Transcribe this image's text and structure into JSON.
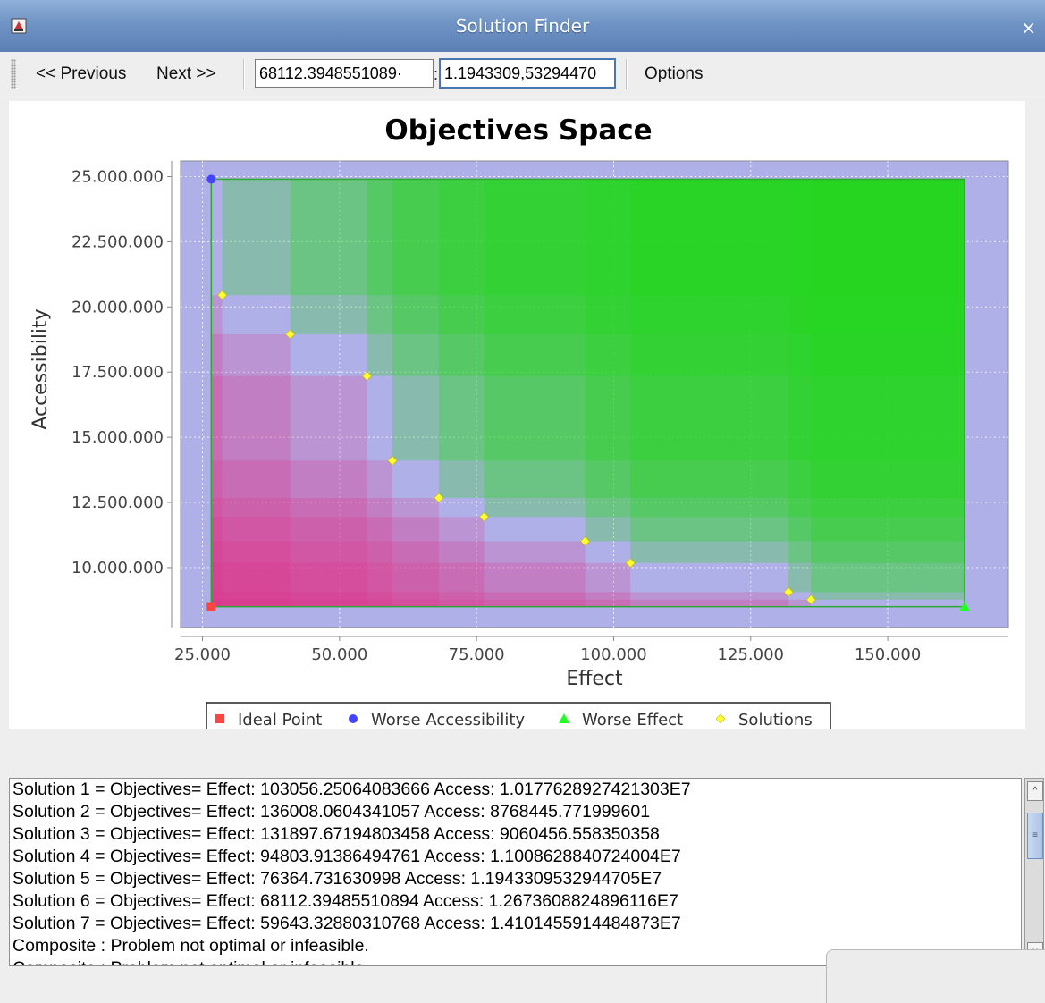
{
  "window": {
    "title": "Solution Finder",
    "close_glyph": "×",
    "app_icon": "app-icon"
  },
  "toolbar": {
    "previous_label": "<< Previous",
    "next_label": "Next >>",
    "field1_value": "68112.3948551089·",
    "colon": ":",
    "field2_value": "1.1943309,53294470",
    "options_label": "Options"
  },
  "chart_data": {
    "type": "scatter",
    "title": "Objectives Space",
    "xlabel": "Effect",
    "ylabel": "Accessibility",
    "xlim": [
      21000,
      172000
    ],
    "ylim": [
      7700000,
      25600000
    ],
    "xticks": [
      25000,
      50000,
      75000,
      100000,
      125000,
      150000
    ],
    "xtick_labels": [
      "25.000",
      "50.000",
      "75.000",
      "100.000",
      "125.000",
      "150.000"
    ],
    "yticks": [
      10000000,
      12500000,
      15000000,
      17500000,
      20000000,
      22500000,
      25000000
    ],
    "ytick_labels": [
      "10.000.000",
      "12.500.000",
      "15.000.000",
      "17.500.000",
      "20.000.000",
      "22.500.000",
      "25.000.000"
    ],
    "grid": true,
    "legend_position": "bottom",
    "colors": {
      "plot_bg": "#b0b0e8",
      "good_region": "#e0338a",
      "bad_region": "#22d61a",
      "ideal": "#ff4444",
      "worse_access": "#4444ff",
      "worse_effect": "#22ff22",
      "solutions": "#ffff33"
    },
    "series": [
      {
        "name": "Ideal Point",
        "marker": "square",
        "color": "#ff4444",
        "points": [
          [
            26600,
            8500000
          ]
        ]
      },
      {
        "name": "Worse Accessibility",
        "marker": "circle",
        "color": "#4444ff",
        "points": [
          [
            26600,
            24900000
          ]
        ]
      },
      {
        "name": "Worse Effect",
        "marker": "triangle",
        "color": "#22ff22",
        "points": [
          [
            164000,
            8500000
          ]
        ]
      },
      {
        "name": "Solutions",
        "marker": "diamond",
        "color": "#ffff33",
        "points": [
          [
            103056.25,
            10177628.9
          ],
          [
            136008.06,
            8768445.8
          ],
          [
            131897.67,
            9060456.6
          ],
          [
            94803.91,
            11008628.8
          ],
          [
            76364.73,
            11943309.5
          ],
          [
            68112.39,
            12673608.8
          ],
          [
            59643.33,
            14101455.9
          ],
          [
            55000,
            17350000
          ],
          [
            41000,
            18950000
          ],
          [
            28600,
            20450000
          ]
        ]
      }
    ]
  },
  "log": {
    "lines": [
      "Solution 1 = Objectives= Effect: 103056.25064083666  Access: 1.0177628927421303E7",
      "Solution 2 = Objectives= Effect: 136008.0604341057  Access: 8768445.771999601",
      "Solution 3 = Objectives= Effect: 131897.67194803458  Access: 9060456.558350358",
      "Solution 4 = Objectives= Effect: 94803.91386494761  Access: 1.1008628840724004E7",
      "Solution 5 = Objectives= Effect: 76364.731630998  Access: 1.1943309532944705E7",
      "Solution 6 = Objectives= Effect: 68112.39485510894  Access: 1.2673608824896116E7",
      "Solution 7 = Objectives= Effect: 59643.32880310768  Access: 1.4101455914484873E7",
      "Composite : Problem not optimal or infeasible.",
      "Composite : Problem not optimal or infeasible."
    ]
  },
  "scrollbar": {
    "up_glyph": "^",
    "down_glyph": "v",
    "thumb_glyph": "≡"
  }
}
